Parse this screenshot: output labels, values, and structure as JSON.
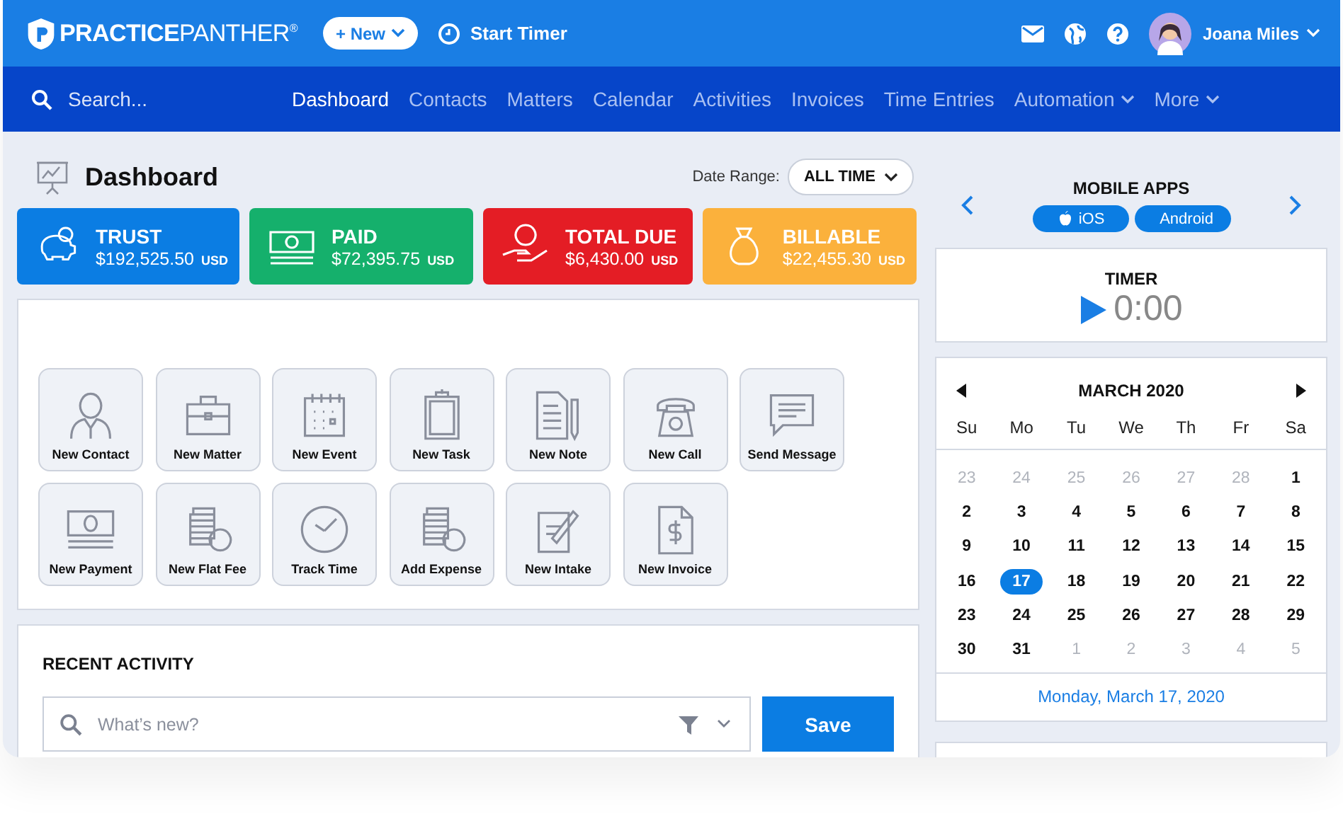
{
  "topbar": {
    "logo": "**PRACTICE**PANTHER$^{®}$",
    "new_button": "+ New",
    "start_timer": "Start Timer",
    "user_name": "Joana Miles"
  },
  "nav": {
    "search_placeholder": "Search...",
    "items": [
      {
        "label": "Dashboard",
        "selected": true,
        "dropdown": false
      },
      {
        "label": "Contacts",
        "selected": false,
        "dropdown": false
      },
      {
        "label": "Matters",
        "selected": false,
        "dropdown": false
      },
      {
        "label": "Calendar",
        "selected": false,
        "dropdown": false
      },
      {
        "label": "Activities",
        "selected": false,
        "dropdown": false
      },
      {
        "label": "Invoices",
        "selected": false,
        "dropdown": false
      },
      {
        "label": "Time Entries",
        "selected": false,
        "dropdown": false
      },
      {
        "label": "Automation",
        "selected": false,
        "dropdown": true
      },
      {
        "label": "More",
        "selected": false,
        "dropdown": true
      }
    ]
  },
  "header": {
    "title": "Dashboard",
    "date_range_label": "Date Range:",
    "date_range_value": "ALL TIME"
  },
  "stats": [
    {
      "kind": "piggy",
      "label": "TRUST",
      "amount": "$192,525.50",
      "currency": "USD",
      "color": "#0b7de3"
    },
    {
      "kind": "cash",
      "label": "PAID",
      "amount": "$72,395.75",
      "currency": "USD",
      "color": "#15b06c"
    },
    {
      "kind": "hand",
      "label": "TOTAL DUE",
      "amount": "$6,430.00",
      "currency": "USD",
      "color": "#e41d25"
    },
    {
      "kind": "bag",
      "label": "BILLABLE",
      "amount": "$22,455.30",
      "currency": "USD",
      "color": "#fbb13c"
    }
  ],
  "quick_actions": [
    {
      "kind": "person",
      "label": "New Contact"
    },
    {
      "kind": "briefcase",
      "label": "New Matter"
    },
    {
      "kind": "calendar",
      "label": "New Event"
    },
    {
      "kind": "clipboard",
      "label": "New Task"
    },
    {
      "kind": "note",
      "label": "New Note"
    },
    {
      "kind": "phone",
      "label": "New Call"
    },
    {
      "kind": "message",
      "label": "Send Message"
    },
    {
      "kind": "cash",
      "label": "New Payment"
    },
    {
      "kind": "coins",
      "label": "New Flat Fee"
    },
    {
      "kind": "clock",
      "label": "Track Time"
    },
    {
      "kind": "coins",
      "label": "Add Expense"
    },
    {
      "kind": "intake",
      "label": "New Intake"
    },
    {
      "kind": "invoice",
      "label": "New Invoice"
    }
  ],
  "recent_activity": {
    "title": "RECENT ACTIVITY",
    "placeholder": "What’s new?",
    "save": "Save"
  },
  "mobile_apps": {
    "title": "MOBILE APPS",
    "buttons": [
      {
        "kind": "apple",
        "label": "iOS"
      },
      {
        "kind": "android",
        "label": "Android"
      }
    ]
  },
  "timer": {
    "title": "TIMER",
    "time": "0:00"
  },
  "calendar": {
    "month": "MARCH 2020",
    "weekdays": [
      "Su",
      "Mo",
      "Tu",
      "We",
      "Th",
      "Fr",
      "Sa"
    ],
    "weeks": [
      [
        {
          "d": "23",
          "muted": true,
          "selected": false
        },
        {
          "d": "24",
          "muted": true,
          "selected": false
        },
        {
          "d": "25",
          "muted": true,
          "selected": false
        },
        {
          "d": "26",
          "muted": true,
          "selected": false
        },
        {
          "d": "27",
          "muted": true,
          "selected": false
        },
        {
          "d": "28",
          "muted": true,
          "selected": false
        },
        {
          "d": "1",
          "muted": false,
          "selected": false
        }
      ],
      [
        {
          "d": "2",
          "muted": false,
          "selected": false
        },
        {
          "d": "3",
          "muted": false,
          "selected": false
        },
        {
          "d": "4",
          "muted": false,
          "selected": false
        },
        {
          "d": "5",
          "muted": false,
          "selected": false
        },
        {
          "d": "6",
          "muted": false,
          "selected": false
        },
        {
          "d": "7",
          "muted": false,
          "selected": false
        },
        {
          "d": "8",
          "muted": false,
          "selected": false
        }
      ],
      [
        {
          "d": "9",
          "muted": false,
          "selected": false
        },
        {
          "d": "10",
          "muted": false,
          "selected": false
        },
        {
          "d": "11",
          "muted": false,
          "selected": false
        },
        {
          "d": "12",
          "muted": false,
          "selected": false
        },
        {
          "d": "13",
          "muted": false,
          "selected": false
        },
        {
          "d": "14",
          "muted": false,
          "selected": false
        },
        {
          "d": "15",
          "muted": false,
          "selected": false
        }
      ],
      [
        {
          "d": "16",
          "muted": false,
          "selected": false
        },
        {
          "d": "17",
          "muted": false,
          "selected": true
        },
        {
          "d": "18",
          "muted": false,
          "selected": false
        },
        {
          "d": "19",
          "muted": false,
          "selected": false
        },
        {
          "d": "20",
          "muted": false,
          "selected": false
        },
        {
          "d": "21",
          "muted": false,
          "selected": false
        },
        {
          "d": "22",
          "muted": false,
          "selected": false
        }
      ],
      [
        {
          "d": "23",
          "muted": false,
          "selected": false
        },
        {
          "d": "24",
          "muted": false,
          "selected": false
        },
        {
          "d": "25",
          "muted": false,
          "selected": false
        },
        {
          "d": "26",
          "muted": false,
          "selected": false
        },
        {
          "d": "27",
          "muted": false,
          "selected": false
        },
        {
          "d": "28",
          "muted": false,
          "selected": false
        },
        {
          "d": "29",
          "muted": false,
          "selected": false
        }
      ],
      [
        {
          "d": "30",
          "muted": false,
          "selected": false
        },
        {
          "d": "31",
          "muted": false,
          "selected": false
        },
        {
          "d": "1",
          "muted": true,
          "selected": false
        },
        {
          "d": "2",
          "muted": true,
          "selected": false
        },
        {
          "d": "3",
          "muted": true,
          "selected": false
        },
        {
          "d": "4",
          "muted": true,
          "selected": false
        },
        {
          "d": "5",
          "muted": true,
          "selected": false
        }
      ]
    ],
    "footer": "Monday, March 17, 2020"
  }
}
